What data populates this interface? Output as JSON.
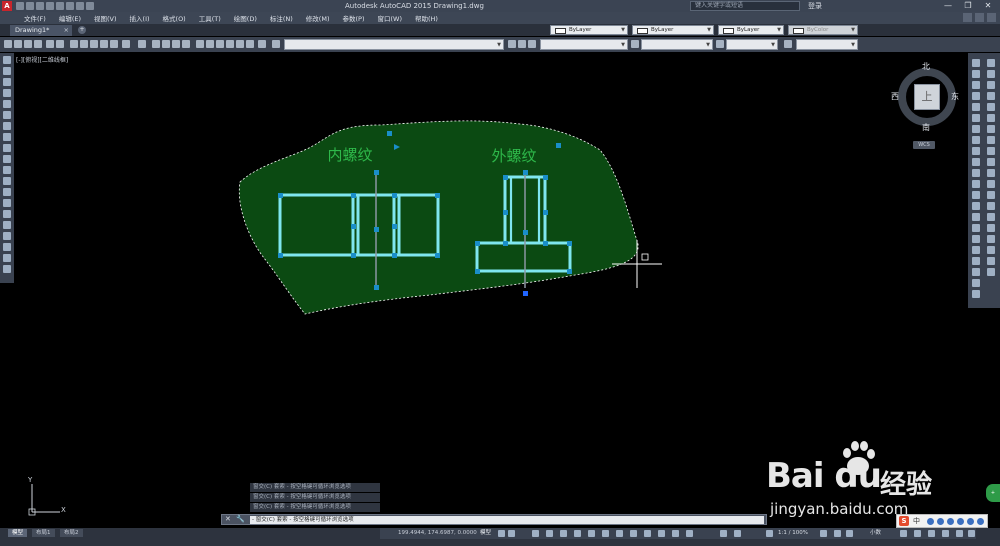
{
  "window": {
    "title": "Autodesk AutoCAD 2015    Drawing1.dwg",
    "search_placeholder": "键入关键字或短语",
    "login_label": "登录",
    "minimize": "—",
    "maximize": "❐",
    "close": "✕",
    "app_letter": "A"
  },
  "menu": {
    "items": [
      "文件(F)",
      "编辑(E)",
      "视图(V)",
      "插入(I)",
      "格式(O)",
      "工具(T)",
      "绘图(D)",
      "标注(N)",
      "修改(M)",
      "参数(P)",
      "窗口(W)",
      "帮助(H)"
    ]
  },
  "tabs": {
    "document": "Drawing1*",
    "document_close": "×",
    "add": "+"
  },
  "layers": {
    "color": "ByLayer",
    "linetype": "ByLayer",
    "lineweight": "ByLayer",
    "plotstyle": "ByColor"
  },
  "viewport": {
    "label": "[-][俯视][二维线框]"
  },
  "drawing": {
    "left_label": "内螺纹",
    "right_label": "外螺纹",
    "hatch_color": "#0b4a12",
    "geometry_color": "#7fe6ef",
    "text_color": "#2eb84a",
    "grip_color": "#1a8ec8"
  },
  "viewcube": {
    "north": "北",
    "south": "南",
    "east": "东",
    "west": "西",
    "top_face": "上",
    "wcs": "WCS"
  },
  "command": {
    "history": [
      "窗交(C) 套索 - 按空格键可循环浏览选项",
      "窗交(C) 套索 - 按空格键可循环浏览选项",
      "窗交(C) 套索 - 按空格键可循环浏览选项"
    ],
    "current": "- 窗交(C) 套索 - 按空格键可循环浏览选项",
    "close": "✕",
    "settings": "🔧"
  },
  "ucs": {
    "x_label": "X",
    "y_label": "Y"
  },
  "layout_tabs": [
    "模型",
    "布局1",
    "布局2"
  ],
  "status": {
    "coordinates": "199.4944, 174.6987, 0.0000",
    "model": "模型",
    "scale": "1:1 / 100%",
    "units": "小数"
  },
  "watermark": {
    "logo": "Bai du",
    "logo_cn": "经验",
    "url": "jingyan.baidu.com"
  },
  "ime": {
    "logo": "S",
    "lang": "中"
  },
  "side_button": "+"
}
